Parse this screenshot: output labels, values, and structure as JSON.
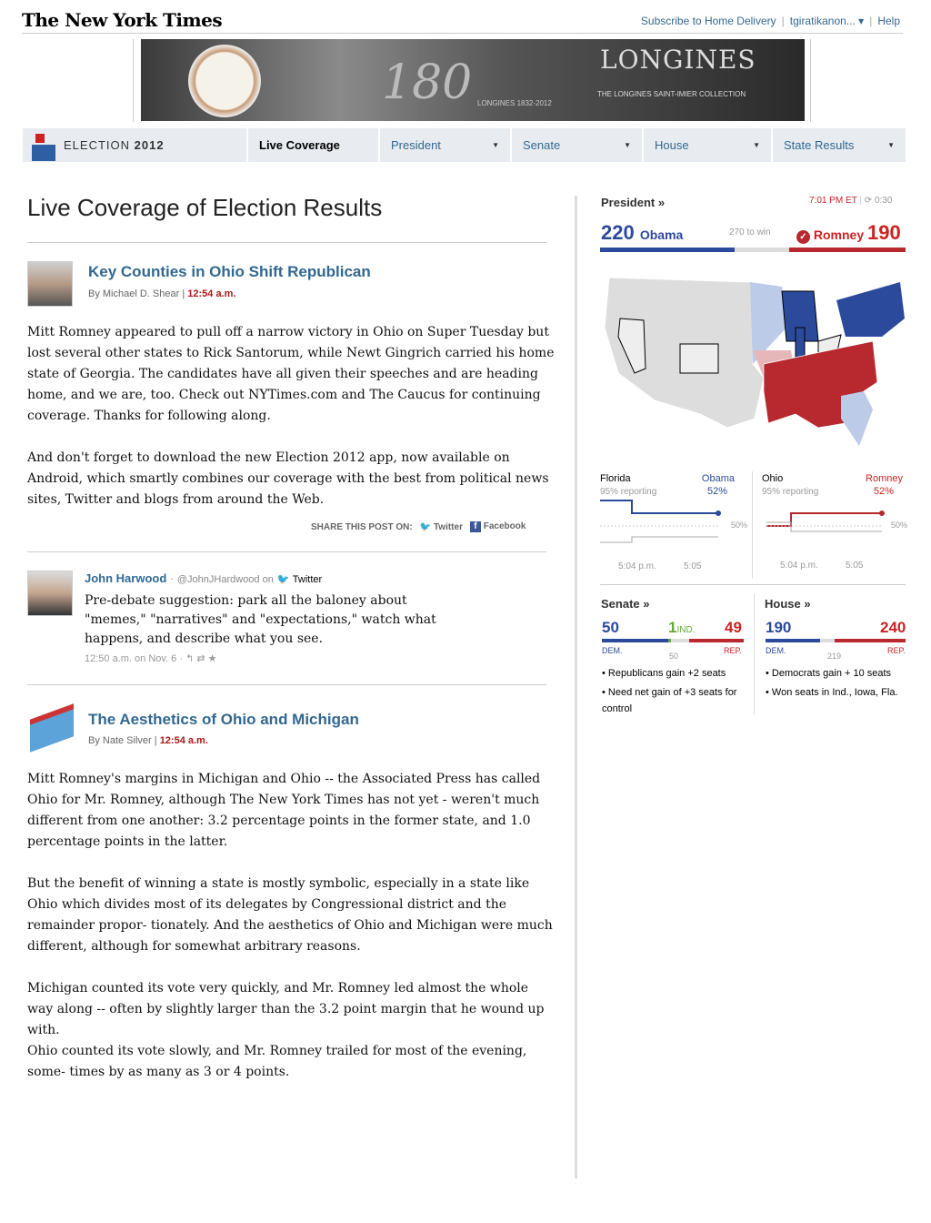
{
  "header": {
    "masthead": "The New York Times",
    "subscribe": "Subscribe to Home Delivery",
    "user": "tgiratikanon...",
    "help": "Help"
  },
  "ad": {
    "brand": "LONGINES",
    "tagline": "THE LONGINES SAINT-IMIER COLLECTION",
    "years": "LONGINES 1832-2012",
    "anniv": "180"
  },
  "nav": {
    "election_label": "ELECTION",
    "election_year": "2012",
    "items": [
      {
        "label": "Live Coverage"
      },
      {
        "label": "President"
      },
      {
        "label": "Senate"
      },
      {
        "label": "House"
      },
      {
        "label": "State Results"
      }
    ]
  },
  "page_title": "Live Coverage of Election Results",
  "posts": [
    {
      "title": "Key Counties in Ohio Shift Republican",
      "by": "By Michael D. Shear",
      "time": "12:54 a.m.",
      "paragraphs": [
        "Mitt Romney appeared to pull off a narrow victory in Ohio on Super Tuesday but lost several other states to Rick Santorum, while Newt Gingrich carried his home state of Georgia. The candidates have all given their speeches and are heading home, and we are, too. Check out NYTimes.com and The Caucus for continuing coverage. Thanks for following along.",
        "And don't forget to download the new Election 2012 app, now available on Android, which smartly combines our coverage with the best from political news sites, Twitter and blogs from around the Web."
      ],
      "share": "SHARE THIS POST ON:",
      "twitter": "Twitter",
      "facebook": "Facebook"
    },
    {
      "title": "The Aesthetics of Ohio and Michigan",
      "by": "By Nate Silver",
      "time": "12:54 a.m.",
      "paragraphs": [
        "Mitt Romney's margins in Michigan and Ohio -- the Associated Press has called Ohio for Mr. Romney, although The New York Times has not yet - weren't much different from one another: 3.2 percentage points in the former state, and 1.0 percentage points in the latter.",
        "But the benefit of winning a state is mostly symbolic, especially in a state like Ohio which divides most of its delegates by Congressional district and the remainder propor- tionately. And the aesthetics of Ohio and Michigan were much different, although for somewhat arbitrary reasons.",
        "Michigan counted its vote very quickly, and Mr. Romney led almost the whole way along -- often by slightly larger than the 3.2 point margin that he wound up with.",
        "Ohio counted its vote slowly, and Mr. Romney trailed for most of the evening, some- times by as many as 3 or 4 points."
      ]
    }
  ],
  "tweet": {
    "name": "John Harwood",
    "handle": "@JohnJHardwood on",
    "via": "Twitter",
    "text": "Pre-debate suggestion: park all the baloney about \"memes,\" \"narratives\" and \"expectations,\" watch what happens, and describe what you see.",
    "time": "12:50 a.m. on Nov. 6"
  },
  "sidebar": {
    "president": {
      "label": "President »",
      "time": "7:01 PM ET",
      "refresh": "0:30",
      "obama_votes": "220",
      "obama": "Obama",
      "to_win": "270 to win",
      "romney": "Romney",
      "romney_votes": "190",
      "obama_frac": 0.44,
      "romney_frac": 0.38
    },
    "florida": {
      "state": "Florida",
      "cand": "Obama",
      "pct": "52%",
      "reporting": "95% reporting",
      "mid": "50%",
      "t1": "5:04 p.m.",
      "t2": "5:05"
    },
    "ohio": {
      "state": "Ohio",
      "cand": "Romney",
      "pct": "52%",
      "reporting": "95% reporting",
      "mid": "50%",
      "t1": "5:04 p.m.",
      "t2": "5:05"
    },
    "senate": {
      "label": "Senate »",
      "dem": "50",
      "ind": "1",
      "ind_label": "IND.",
      "rep": "49",
      "dem_label": "DEM.",
      "rep_label": "REP.",
      "mid": "50",
      "notes": [
        "• Republicans gain +2 seats",
        "• Need net gain of +3 seats for control"
      ]
    },
    "house": {
      "label": "House »",
      "dem": "190",
      "rep": "240",
      "dem_label": "DEM.",
      "rep_label": "REP.",
      "mid": "219",
      "notes": [
        "• Democrats gain + 10 seats",
        "• Won seats in Ind., Iowa, Fla."
      ]
    }
  },
  "colors": {
    "dem": "#2c4a9c",
    "rep": "#b8292f",
    "nav_bg": "#e8ecf0",
    "link": "#326891"
  }
}
